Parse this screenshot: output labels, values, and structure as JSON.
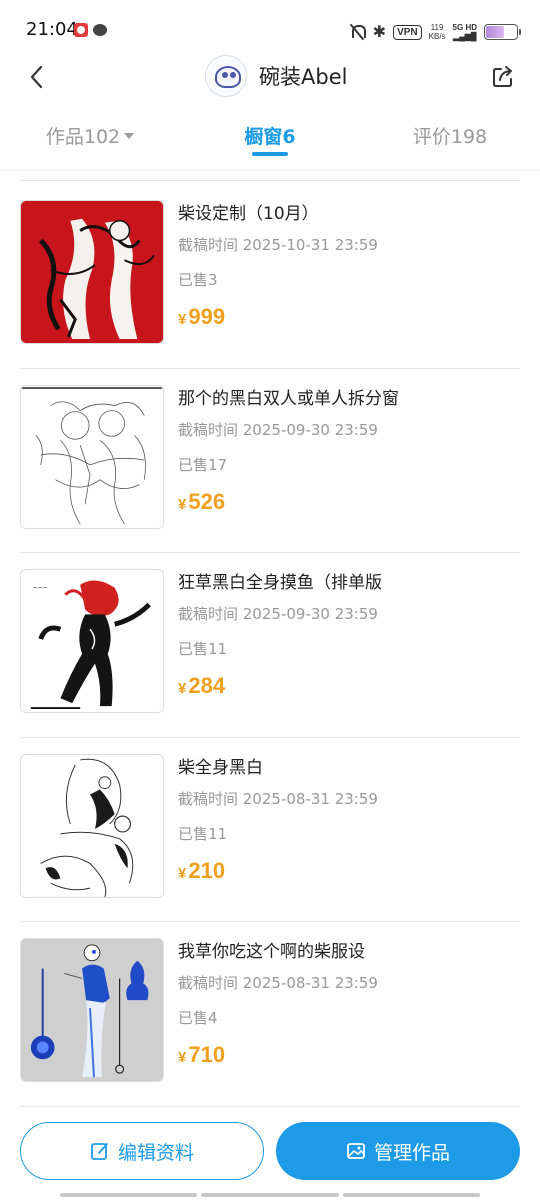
{
  "status_bar": {
    "time": "21:04",
    "vpn": "VPN",
    "speed_value": "119",
    "speed_unit": "KB/s",
    "network": "5G HD",
    "battery_level": 0.6
  },
  "header": {
    "profile_name": "碗装Abel"
  },
  "tabs": [
    {
      "label": "作品102",
      "active": false
    },
    {
      "label": "橱窗6",
      "active": true
    },
    {
      "label": "评价198",
      "active": false
    }
  ],
  "products": [
    {
      "title": "柴设定制（10月）",
      "deadline": "截稿时间 2025-10-31 23:59",
      "sold": "已售3",
      "currency": "¥",
      "price": "999"
    },
    {
      "title": "那个的黑白双人或单人拆分窗",
      "deadline": "截稿时间 2025-09-30 23:59",
      "sold": "已售17",
      "currency": "¥",
      "price": "526"
    },
    {
      "title": "狂草黑白全身摸鱼（排单版",
      "deadline": "截稿时间 2025-09-30 23:59",
      "sold": "已售11",
      "currency": "¥",
      "price": "284"
    },
    {
      "title": "柴全身黑白",
      "deadline": "截稿时间 2025-08-31 23:59",
      "sold": "已售11",
      "currency": "¥",
      "price": "210"
    },
    {
      "title": "我草你吃这个啊的柴服设",
      "deadline": "截稿时间 2025-08-31 23:59",
      "sold": "已售4",
      "currency": "¥",
      "price": "710"
    }
  ],
  "bottom": {
    "edit_label": "编辑资料",
    "manage_label": "管理作品"
  },
  "colors": {
    "accent": "#1e9be6",
    "price": "#f0a01e"
  }
}
